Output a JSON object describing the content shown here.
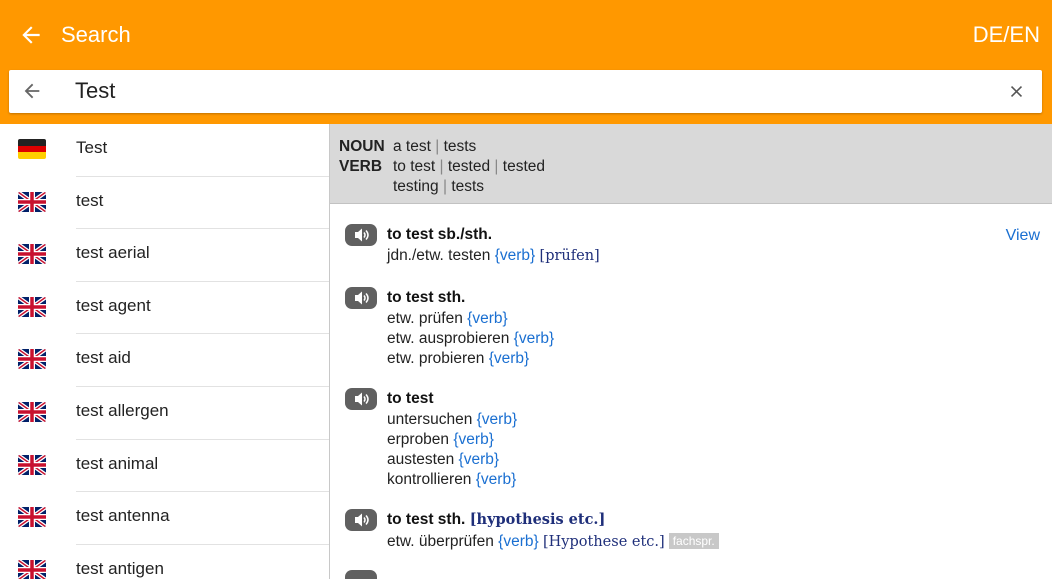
{
  "appbar": {
    "title": "Search",
    "lang": "DE/EN",
    "back_icon": "arrow-left-icon"
  },
  "search": {
    "value": "Test",
    "back_icon": "arrow-left-icon",
    "clear_icon": "close-icon"
  },
  "colors": {
    "accent": "#ff9800",
    "link": "#1a6fd1"
  },
  "results": [
    {
      "flag": "de",
      "label": "Test"
    },
    {
      "flag": "gb",
      "label": "test"
    },
    {
      "flag": "gb",
      "label": "test aerial"
    },
    {
      "flag": "gb",
      "label": "test agent"
    },
    {
      "flag": "gb",
      "label": "test aid"
    },
    {
      "flag": "gb",
      "label": "test allergen"
    },
    {
      "flag": "gb",
      "label": "test animal"
    },
    {
      "flag": "gb",
      "label": "test antenna"
    },
    {
      "flag": "gb",
      "label": "test antigen"
    }
  ],
  "grammar": {
    "noun_tag": "NOUN",
    "noun_1": "a test",
    "noun_2": "tests",
    "verb_tag": "VERB",
    "verb_1": "to test",
    "verb_2": "tested",
    "verb_3": "tested",
    "verb_4": "testing",
    "verb_5": "tests",
    "pipe": "|"
  },
  "view_label": "View",
  "entries": {
    "e1": {
      "head": "to test sb./sth.",
      "l1": "jdn./etw. testen",
      "l1_tag": "{verb}",
      "l1_gloss": "[prüfen]"
    },
    "e2": {
      "head": "to test sth.",
      "l1": "etw. prüfen",
      "l2": "etw. ausprobieren",
      "l3": "etw. probieren",
      "tag": "{verb}"
    },
    "e3": {
      "head": "to test",
      "l1": "untersuchen",
      "l2": "erproben",
      "l3": "austesten",
      "l4": "kontrollieren",
      "tag": "{verb}"
    },
    "e4": {
      "head": "to test sth.",
      "head_gloss": "[hypothesis etc.]",
      "l1": "etw. überprüfen",
      "l1_tag": "{verb}",
      "l1_gloss": "[Hypothese etc.]",
      "badge": "fachspr."
    }
  }
}
